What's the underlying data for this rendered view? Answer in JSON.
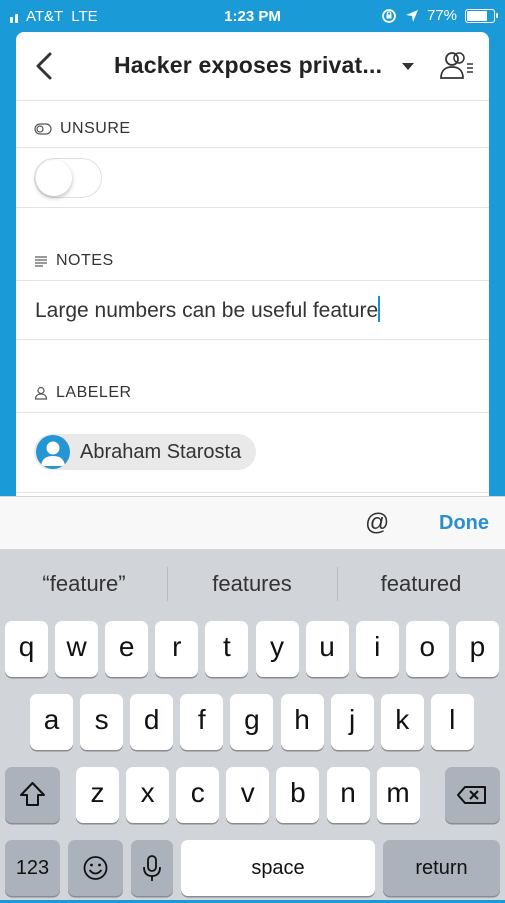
{
  "status_bar": {
    "carrier": "AT&T",
    "network": "LTE",
    "time": "1:23 PM",
    "battery_percent": "77%",
    "battery_level": 0.77
  },
  "nav": {
    "title": "Hacker exposes privat..."
  },
  "unsure": {
    "label": "UNSURE",
    "toggle_on": false
  },
  "notes": {
    "label": "NOTES",
    "value": "Large numbers can be useful feature"
  },
  "labeler": {
    "label": "LABELER",
    "name": "Abraham Starosta"
  },
  "accessory": {
    "at": "@",
    "done": "Done"
  },
  "keyboard": {
    "suggestions": [
      "“feature”",
      "features",
      "featured"
    ],
    "row1": [
      "q",
      "w",
      "e",
      "r",
      "t",
      "y",
      "u",
      "i",
      "o",
      "p"
    ],
    "row2": [
      "a",
      "s",
      "d",
      "f",
      "g",
      "h",
      "j",
      "k",
      "l"
    ],
    "row3": [
      "z",
      "x",
      "c",
      "v",
      "b",
      "n",
      "m"
    ],
    "numbers_key": "123",
    "space_key": "space",
    "return_key": "return"
  },
  "colors": {
    "accent": "#1a9ad6",
    "done": "#2b8fce"
  }
}
